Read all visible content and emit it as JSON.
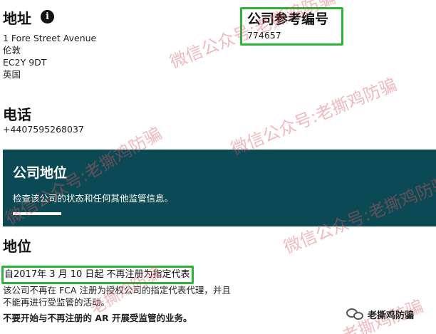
{
  "address": {
    "heading": "地址",
    "info_icon": "i",
    "lines": [
      "1 Fore Street Avenue",
      "伦敦",
      "EC2Y 9DT",
      "英国"
    ]
  },
  "company_reference": {
    "heading": "公司参考编号",
    "value": "774657"
  },
  "phone": {
    "heading": "电话",
    "value": "+4407595268037"
  },
  "status_banner": {
    "title": "公司地位",
    "description": "检查该公司的状态和任何其他监管信息。"
  },
  "status": {
    "heading": "地位",
    "date_line": "自2017年 3 月 10 日起 不再注册为指定代表",
    "description_lines": [
      "该公司不再在 FCA 注册为授权公司的指定代表代理，并且",
      "不能再进行受监管的活动。"
    ],
    "warning": "不要开始与不再注册的 AR 开展受监管的业务。"
  },
  "watermark": {
    "text_1": "微信公众号:老撕鸡防骗",
    "text_2": "老撕鸡防骗"
  },
  "badge": {
    "icon": "wechat-icon",
    "label": "老撕鸡防骗"
  },
  "colors": {
    "banner_bg": "#0b4a54",
    "highlight_border": "#2db336",
    "watermark": "#de5864"
  }
}
